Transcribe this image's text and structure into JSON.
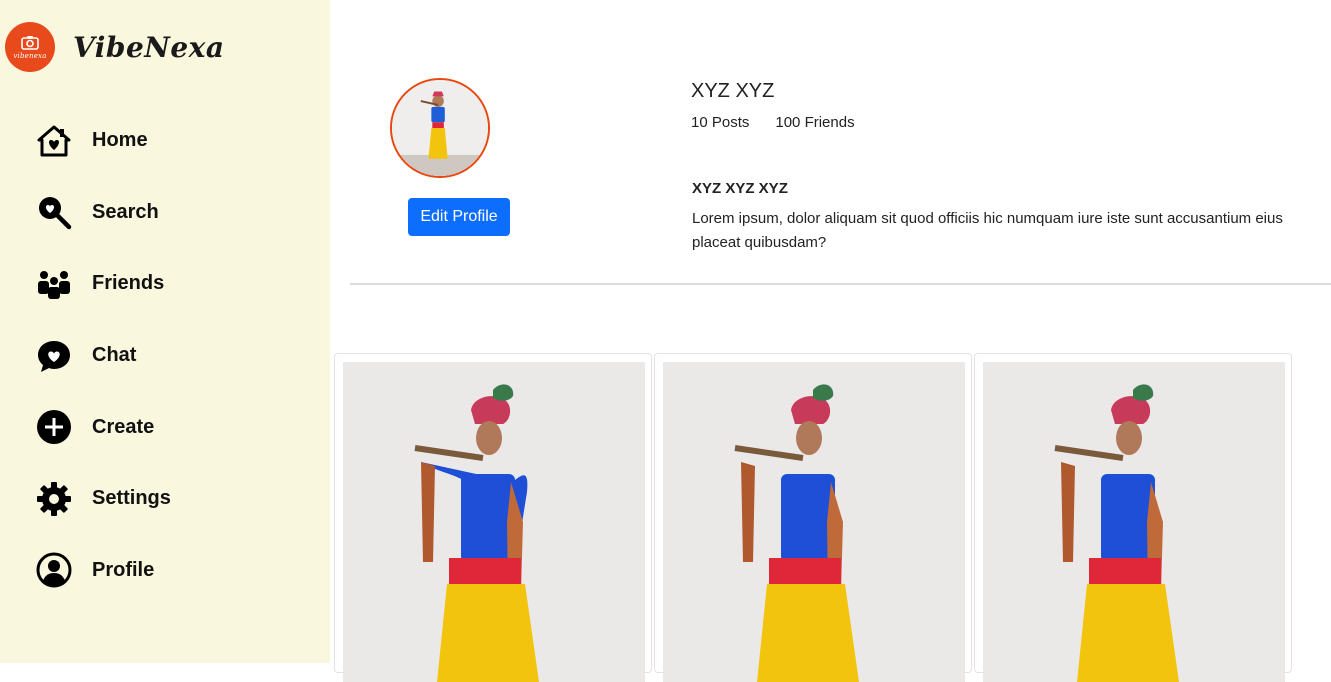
{
  "brand": {
    "logo_text": "vibenexa",
    "name": "VibeNexa"
  },
  "sidebar": {
    "items": [
      {
        "label": "Home",
        "icon": "home-icon"
      },
      {
        "label": "Search",
        "icon": "search-icon"
      },
      {
        "label": "Friends",
        "icon": "friends-icon"
      },
      {
        "label": "Chat",
        "icon": "chat-icon"
      },
      {
        "label": "Create",
        "icon": "create-icon"
      },
      {
        "label": "Settings",
        "icon": "settings-icon"
      },
      {
        "label": "Profile",
        "icon": "profile-icon"
      }
    ]
  },
  "profile": {
    "username": "XYZ XYZ",
    "posts_count": "10 Posts",
    "friends_count": "100 Friends",
    "full_name": "XYZ XYZ XYZ",
    "bio": "Lorem ipsum, dolor aliquam sit quod officiis hic numquam iure iste sunt accusantium eius placeat quibusdam?",
    "edit_label": "Edit Profile"
  },
  "colors": {
    "sidebar_bg": "#faf7df",
    "logo_bg": "#e84a1c",
    "button": "#0d6efd",
    "avatar_border": "#e8480e"
  }
}
